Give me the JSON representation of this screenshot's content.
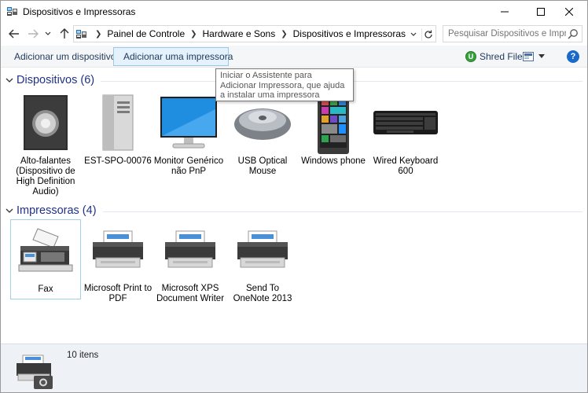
{
  "window": {
    "title": "Dispositivos e Impressoras"
  },
  "address": {
    "breadcrumbs": [
      "Painel de Controle",
      "Hardware e Sons",
      "Dispositivos e Impressoras"
    ]
  },
  "search": {
    "placeholder": "Pesquisar Dispositivos e Impr..."
  },
  "commands": {
    "add_device": "Adicionar um dispositivo",
    "add_printer": "Adicionar uma impressora",
    "shred_file": "Shred File"
  },
  "tooltip": {
    "text": "Iniciar o Assistente para Adicionar Impressora, que ajuda a instalar uma impressora"
  },
  "devices_group": {
    "label": "Dispositivos (6)",
    "items": [
      {
        "label": "Alto-falantes (Dispositivo de High Definition Audio)",
        "icon": "speaker-icon"
      },
      {
        "label": "EST-SPO-00076",
        "icon": "computer-tower-icon"
      },
      {
        "label": "Monitor Genérico não PnP",
        "icon": "monitor-icon"
      },
      {
        "label": "USB Optical Mouse",
        "icon": "mouse-icon"
      },
      {
        "label": "Windows phone",
        "icon": "phone-icon"
      },
      {
        "label": "Wired Keyboard 600",
        "icon": "keyboard-icon"
      }
    ]
  },
  "printers_group": {
    "label": "Impressoras (4)",
    "items": [
      {
        "label": "Fax",
        "icon": "fax-icon"
      },
      {
        "label": "Microsoft Print to PDF",
        "icon": "printer-icon"
      },
      {
        "label": "Microsoft XPS Document Writer",
        "icon": "printer-icon"
      },
      {
        "label": "Send To OneNote 2013",
        "icon": "printer-icon"
      }
    ]
  },
  "details": {
    "count": "10 itens"
  },
  "colors": {
    "accent": "#1e3287",
    "selection_border": "#a0d0ea",
    "command_hover": "#e5f1fb"
  }
}
